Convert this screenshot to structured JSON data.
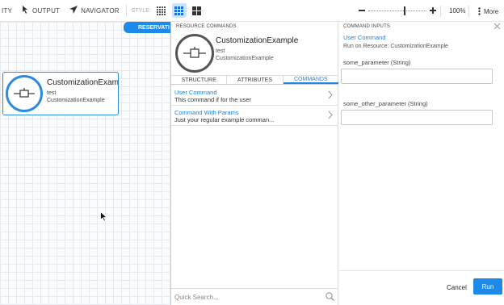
{
  "toolbar": {
    "ity_label": "ITY",
    "output_label": "OUTPUT",
    "navigator_label": "NAVIGATOR",
    "style_label": "STYLE:",
    "zoom_percent": "100%",
    "more_label": "More"
  },
  "canvas": {
    "reservation_tab": "RESERVATI",
    "resource": {
      "name": "CustomizationExam...",
      "line1": "test",
      "line2": "CustomizationExample"
    }
  },
  "resource_commands": {
    "header": "RESOURCE COMMANDS",
    "name": "CustomizationExample",
    "line1": "test",
    "line2": "CustomizationExample",
    "tabs": [
      "STRUCTURE",
      "ATTRIBUTES",
      "COMMANDS"
    ],
    "active_tab": "COMMANDS",
    "commands": [
      {
        "title": "User Command",
        "description": "This command if for the user"
      },
      {
        "title": "Command With Params",
        "description": "Just your regular example comman..."
      }
    ],
    "search_placeholder": "Quick Search..."
  },
  "command_inputs": {
    "header": "COMMAND INPUTS",
    "title": "User Command",
    "subtitle": "Run on Resource: CustomizationExample",
    "params": [
      {
        "label": "some_parameter (String)",
        "value": ""
      },
      {
        "label": "some_other_parameter (String)",
        "value": ""
      }
    ],
    "cancel_label": "Cancel",
    "run_label": "Run"
  },
  "colors": {
    "accent": "#1e8ae8",
    "link": "#1e7fd6"
  }
}
